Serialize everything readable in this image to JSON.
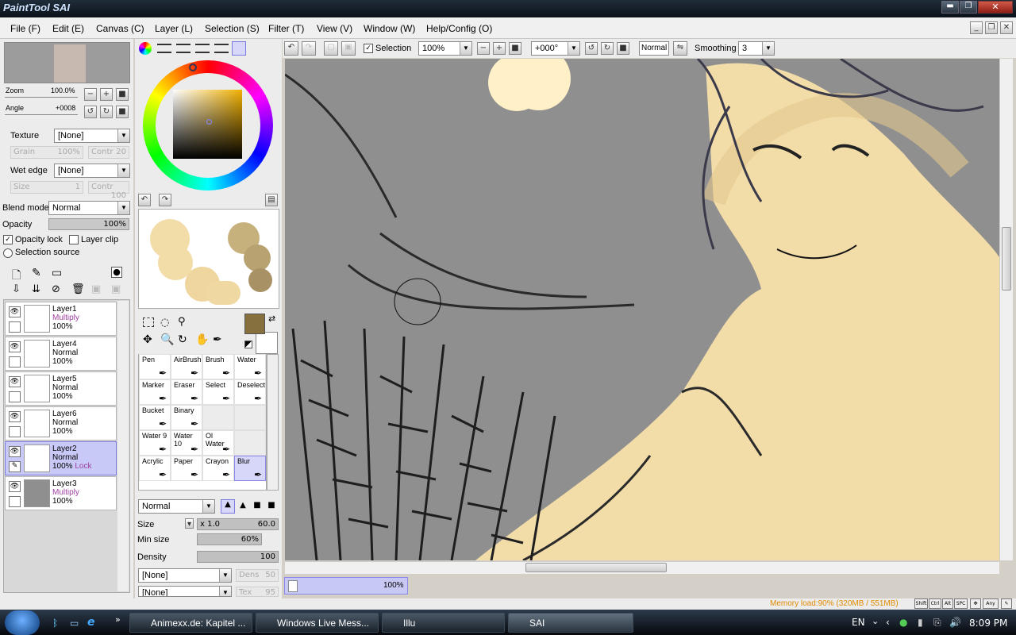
{
  "window": {
    "app_title": "PaintTool SAI"
  },
  "menu": [
    "File (F)",
    "Edit (E)",
    "Canvas (C)",
    "Layer (L)",
    "Selection (S)",
    "Filter (T)",
    "View (V)",
    "Window (W)",
    "Help/Config (O)"
  ],
  "navigator": {
    "zoom_label": "Zoom",
    "zoom_value": "100.0%",
    "angle_label": "Angle",
    "angle_value": "+0008"
  },
  "brush_options": {
    "texture_label": "Texture",
    "texture_value": "[None]",
    "grain_label": "Grain",
    "grain_value": "100%",
    "contr_label": "Contr",
    "contr_value": "20",
    "wet_edge_label": "Wet edge",
    "wet_edge_value": "[None]",
    "size_label": "Size",
    "size_value": "1",
    "contr2_value": "100"
  },
  "layer_options": {
    "blend_label": "Blend mode",
    "blend_value": "Normal",
    "opacity_label": "Opacity",
    "opacity_value": "100%",
    "opacity_lock": "Opacity lock",
    "layer_clip": "Layer clip",
    "selection_source": "Selection source"
  },
  "layers": [
    {
      "name": "Layer1",
      "mode": "Multiply",
      "opacity": "100%",
      "lock": ""
    },
    {
      "name": "Layer4",
      "mode": "Normal",
      "opacity": "100%",
      "lock": ""
    },
    {
      "name": "Layer5",
      "mode": "Normal",
      "opacity": "100%",
      "lock": ""
    },
    {
      "name": "Layer6",
      "mode": "Normal",
      "opacity": "100%",
      "lock": ""
    },
    {
      "name": "Layer2",
      "mode": "Normal",
      "opacity": "100%",
      "lock": "Lock"
    },
    {
      "name": "Layer3",
      "mode": "Multiply",
      "opacity": "100%",
      "lock": ""
    }
  ],
  "tools": [
    {
      "name": "Pen"
    },
    {
      "name": "AirBrush"
    },
    {
      "name": "Brush"
    },
    {
      "name": "Water"
    },
    {
      "name": "Marker"
    },
    {
      "name": "Eraser"
    },
    {
      "name": "Select"
    },
    {
      "name": "Deselect"
    },
    {
      "name": "Bucket"
    },
    {
      "name": "Binary"
    },
    {
      "name": ""
    },
    {
      "name": ""
    },
    {
      "name": "Water 9"
    },
    {
      "name": "Water 10"
    },
    {
      "name": "Ol Water"
    },
    {
      "name": ""
    },
    {
      "name": "Acrylic"
    },
    {
      "name": "Paper"
    },
    {
      "name": "Crayon"
    },
    {
      "name": "Blur"
    }
  ],
  "brush": {
    "mode": "Normal",
    "size_label": "Size",
    "size_mult": "x 1.0",
    "size_value": "60.0",
    "min_size_label": "Min size",
    "min_size_value": "60%",
    "density_label": "Density",
    "density_value": "100",
    "tex1": "[None]",
    "tex1_label": "Dens",
    "tex1_value": "50",
    "tex2": "[None]",
    "tex2_label": "Tex",
    "tex2_value": "95"
  },
  "canvas_toolbar": {
    "selection_label": "Selection",
    "zoom": "100%",
    "angle": "+000°",
    "mode": "Normal",
    "smoothing_label": "Smoothing",
    "smoothing_value": "3"
  },
  "canvas_tab": {
    "name": "",
    "zoom": "100%"
  },
  "status": {
    "memory": "Memory load:90% (320MB / 551MB)",
    "keys": [
      "Shift",
      "Ctrl",
      "Alt",
      "SPC",
      "Any"
    ]
  },
  "taskbar": {
    "tasks": [
      "Animexx.de: Kapitel ...",
      "Windows Live Mess...",
      "Illu",
      "SAI"
    ],
    "lang": "EN",
    "time": "8:09 PM"
  },
  "colors": {
    "accent": "#7a7ae0",
    "fg_swatch": "#86713e",
    "skin": "#f2dca8",
    "canvas_bg": "#8f8f8f"
  }
}
